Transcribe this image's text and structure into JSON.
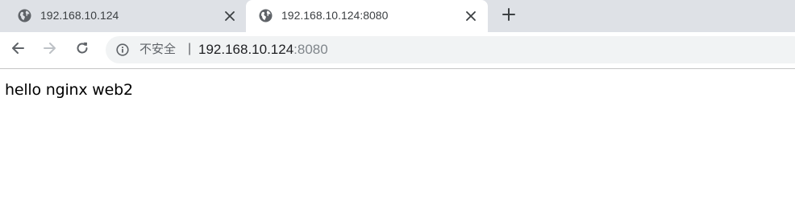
{
  "tabs": [
    {
      "title": "192.168.10.124",
      "active": false,
      "icon": "globe-icon"
    },
    {
      "title": "192.168.10.124:8080",
      "active": true,
      "icon": "globe-icon"
    }
  ],
  "toolbar": {
    "security_label": "不安全",
    "security_separator": "|",
    "url_host": "192.168.10.124",
    "url_port": ":8080"
  },
  "page": {
    "body_text": "hello nginx web2"
  },
  "colors": {
    "tabstrip_bg": "#dee1e6",
    "omnibox_bg": "#f1f3f4",
    "icon_gray": "#5f6368",
    "url_dim": "#80868b"
  }
}
